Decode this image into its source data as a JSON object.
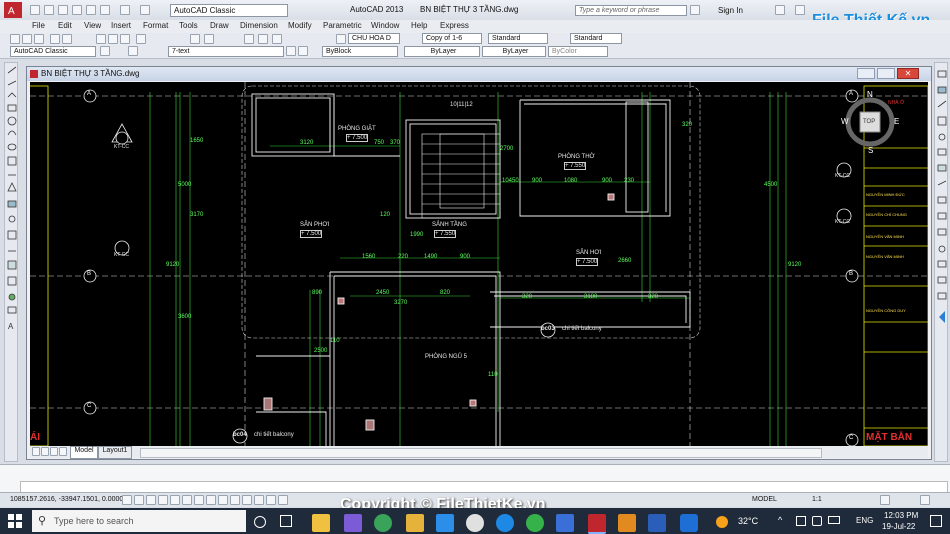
{
  "titlebar": {
    "app": "AutoCAD 2013",
    "file": "BN BIỆT THỰ 3 TẦNG.dwg",
    "workspace": "AutoCAD Classic",
    "search_placeholder": "Type a keyword or phrase",
    "signin": "Sign In"
  },
  "menu": [
    "File",
    "Edit",
    "View",
    "Insert",
    "Format",
    "Tools",
    "Draw",
    "Dimension",
    "Modify",
    "Parametric",
    "Window",
    "Help",
    "Express"
  ],
  "toolbar": {
    "layer": "7-text",
    "textstyle": "CHU HOA D",
    "dimstyle": "Copy of 1-6",
    "tablestyle": "Standard",
    "mlstyle": "Standard",
    "workspace2": "AutoCAD Classic",
    "color": "ByBlock",
    "linetype": "ByLayer",
    "lineweight": "ByLayer",
    "plotstyle": "ByColor"
  },
  "document": {
    "title": "BN BIỆT THỰ 3 TẦNG.dwg"
  },
  "tabs": {
    "model": "Model",
    "layout": "Layout1"
  },
  "viewcube": {
    "n": "N",
    "s": "S",
    "e": "E",
    "w": "W",
    "top": "TOP"
  },
  "rooms": [
    {
      "name": "PHÒNG GIẶT",
      "level": "+ 7.500"
    },
    {
      "name": "PHÒNG THỜ",
      "level": "+ 7.550"
    },
    {
      "name": "SÂN PHƠI",
      "level": "+ 7.500"
    },
    {
      "name": "SẢNH TẦNG",
      "level": "+ 7.550"
    },
    {
      "name": "SÂN HƠI",
      "level": "+ 7.500"
    },
    {
      "name": "PHÒNG NGỦ 5",
      "level": ""
    }
  ],
  "labels": {
    "bc03": "bc03",
    "bc04": "bc04",
    "balcony": "chi tiết balcony",
    "ktcc": "KT-CC",
    "mat_ban": "MẶT BẰN",
    "left_cut": "ÁI",
    "logo": "File Thiết Kế.vn",
    "watermark": "Copyright © FileThietKe.vn",
    "stair_top": "10|11|12",
    "title_right": "NHÀ Ở"
  },
  "dimensions": [
    "3120",
    "750",
    "370",
    "10450",
    "900",
    "1080",
    "900",
    "230",
    "1560",
    "220",
    "1490",
    "900",
    "2450",
    "820",
    "3270",
    "3180",
    "320",
    "2500",
    "3600",
    "9120",
    "5000",
    "3170",
    "4500",
    "2700",
    "1650",
    "150",
    "120",
    "110",
    "890",
    "1990",
    "2660"
  ],
  "titleblock": [
    "NGUYỄN MINH ĐỨC",
    "NGUYỄN CHÍ CHUNG",
    "NGUYỄN VĂN MINH",
    "NGUYỄN VĂN MINH",
    "NGUYỄN CÔNG DUY"
  ],
  "command": {
    "prompt": "",
    "coords": "1085157.2616, -33947.1501, 0.0000",
    "model": "MODEL",
    "scale": "1:1"
  },
  "taskbar": {
    "search": "Type here to search",
    "temp": "32°C",
    "lang": "ENG",
    "time": "12:03 PM",
    "date": "19-Jul-22"
  }
}
